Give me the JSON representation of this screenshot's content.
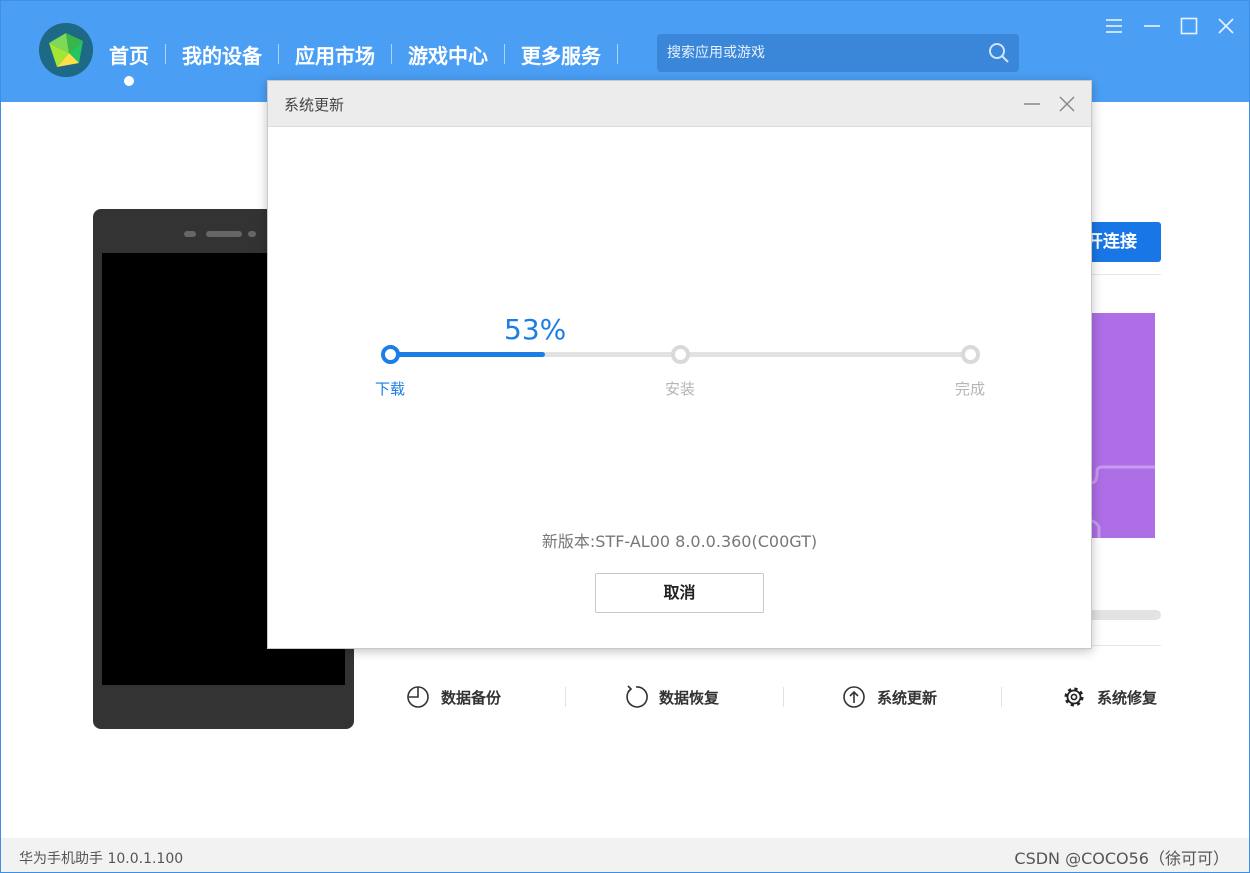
{
  "app": {
    "nav": [
      {
        "label": "首页",
        "active": true
      },
      {
        "label": "我的设备",
        "active": false
      },
      {
        "label": "应用市场",
        "active": false
      },
      {
        "label": "游戏中心",
        "active": false
      },
      {
        "label": "更多服务",
        "active": false
      }
    ],
    "search_placeholder": "搜索应用或游戏",
    "window_controls": [
      "menu-icon",
      "minimize-icon",
      "maximize-icon",
      "close-icon"
    ]
  },
  "background": {
    "connect_button_label": "开连接",
    "tools": [
      {
        "label": "数据备份",
        "icon": "backup-icon"
      },
      {
        "label": "数据恢复",
        "icon": "restore-icon"
      },
      {
        "label": "系统更新",
        "icon": "update-icon"
      },
      {
        "label": "系统修复",
        "icon": "gear-icon"
      }
    ]
  },
  "statusbar": {
    "version": "华为手机助手 10.0.1.100",
    "watermark": "CSDN @COCO56（徐可可）"
  },
  "dialog": {
    "title": "系统更新",
    "progress_percent": 53,
    "progress_label": "53%",
    "steps": [
      {
        "label": "下载",
        "state": "active"
      },
      {
        "label": "安装",
        "state": "pending"
      },
      {
        "label": "完成",
        "state": "pending"
      }
    ],
    "new_version": "新版本:STF-AL00 8.0.0.360(C00GT)",
    "cancel_label": "取消"
  },
  "colors": {
    "topbar": "#4a9ff5",
    "accent": "#1a7ee6",
    "purple_card": "#ad6ee6"
  }
}
